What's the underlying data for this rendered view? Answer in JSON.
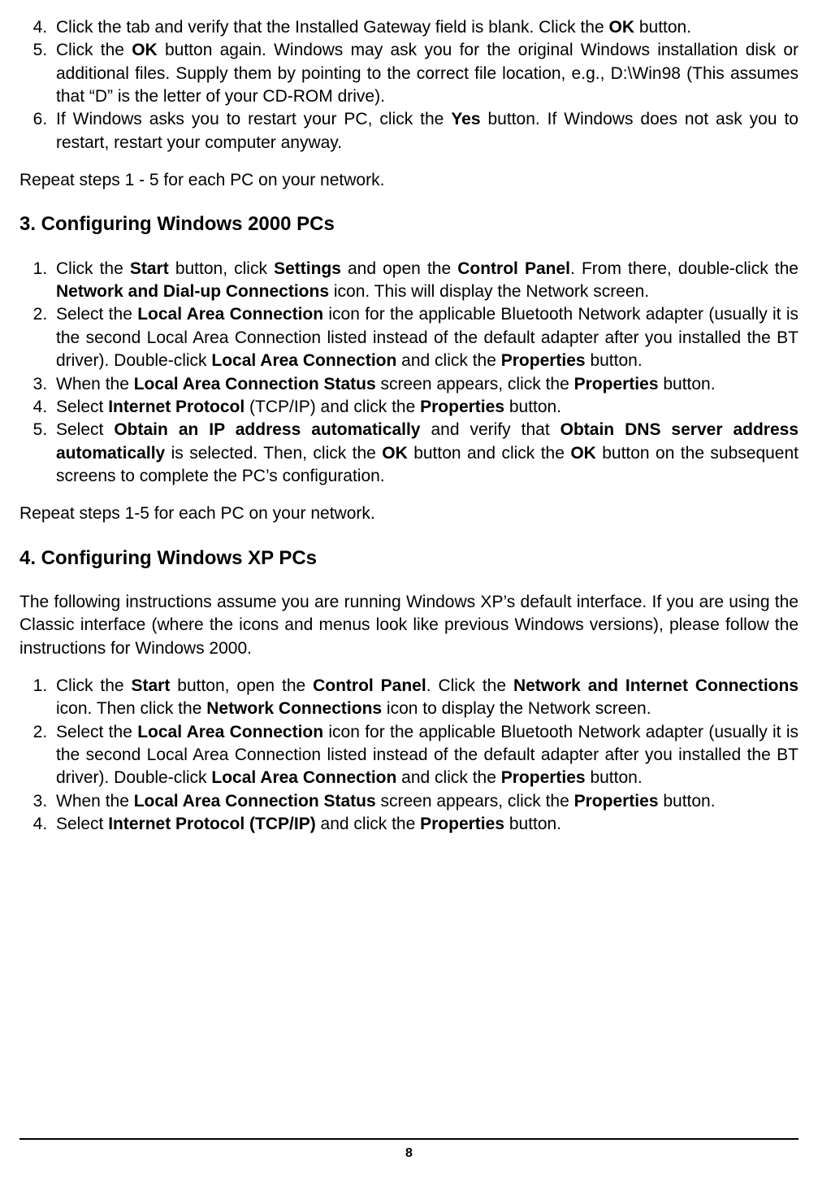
{
  "listA": {
    "start": 4,
    "items": [
      {
        "pre": "Click the tab and verify that the Installed Gateway field is blank. Click the ",
        "b1": "OK",
        "post1": " button."
      },
      {
        "pre": "Click the ",
        "b1": "OK",
        "post1": " button again. Windows may ask you for the original Windows installation disk or additional files. Supply them by pointing to the correct file location, e.g., D:\\Win98 (This assumes that “D” is the letter of your CD-ROM drive)."
      },
      {
        "pre": "If Windows asks you to restart your PC, click the ",
        "b1": "Yes",
        "post1": " button. If Windows does not ask you to restart, restart your computer anyway."
      }
    ]
  },
  "repeat1": "Repeat steps 1 - 5 for each PC on your network.",
  "headingB": "3. Configuring Windows 2000 PCs",
  "listB": {
    "start": 1,
    "items": [
      {
        "pre": "Click the ",
        "b1": "Start",
        "mid1": " button, click ",
        "b2": "Settings",
        "mid2": " and open the ",
        "b3": "Control Panel",
        "mid3": ".  From there, double-click the ",
        "b4": "Network and Dial-up Connections",
        "post": " icon. This will display the Network screen."
      },
      {
        "pre": "Select the ",
        "b1": "Local Area Connection",
        "mid1": " icon for the applicable Bluetooth Network adapter (usually it is the second Local Area Connection listed instead of the default adapter after you installed the BT driver). Double-click ",
        "b2": "Local Area Connection",
        "mid2": " and click the ",
        "b3": "Properties",
        "post": " button."
      },
      {
        "pre": "When the ",
        "b1": "Local Area Connection Status",
        "mid1": " screen appears, click the ",
        "b2": "Properties",
        "post": " button."
      },
      {
        "pre": "Select ",
        "b1": "Internet Protocol",
        "mid1": " (TCP/IP) and click the ",
        "b2": "Properties",
        "post": " button."
      },
      {
        "pre": "Select ",
        "b1": "Obtain an IP address automatically",
        "mid1": " and verify that ",
        "b2": "Obtain DNS server address automatically",
        "mid2": " is selected. Then, click the ",
        "b3": "OK",
        "mid3": " button and click the ",
        "b4": "OK",
        "post": " button on the subsequent screens to complete the PC’s configuration."
      }
    ]
  },
  "repeat2": "Repeat steps 1-5 for each PC on your network.",
  "headingC": "4. Configuring Windows XP PCs",
  "paraC": "The following instructions assume you are running Windows XP’s default interface.  If you are using the Classic interface (where the icons and menus look like previous Windows versions), please follow the instructions for Windows 2000.",
  "listC": {
    "start": 1,
    "items": [
      {
        "pre": "Click the ",
        "b1": "Start",
        "mid1": " button, open the ",
        "b2": "Control Panel",
        "mid2": ". Click the ",
        "b3": "Network and Internet Connections",
        "mid3": " icon. Then click the ",
        "b4": "Network Connections",
        "post": " icon to display the Network screen."
      },
      {
        "pre": "Select the ",
        "b1": "Local Area Connection",
        "mid1": " icon for the applicable Bluetooth Network adapter (usually it is the second Local Area Connection listed instead of the default adapter after you installed the BT driver). Double-click ",
        "b2": "Local Area Connection",
        "mid2": " and click the ",
        "b3": "Properties",
        "post": " button."
      },
      {
        "pre": "When the ",
        "b1": "Local Area Connection Status",
        "mid1": " screen appears, click the ",
        "b2": "Properties",
        "post": " button."
      },
      {
        "pre": "Select ",
        "b1": "Internet Protocol (TCP/IP)",
        "mid1": " and click the ",
        "b2": "Properties",
        "post": " button."
      }
    ]
  },
  "pageNumber": "8"
}
